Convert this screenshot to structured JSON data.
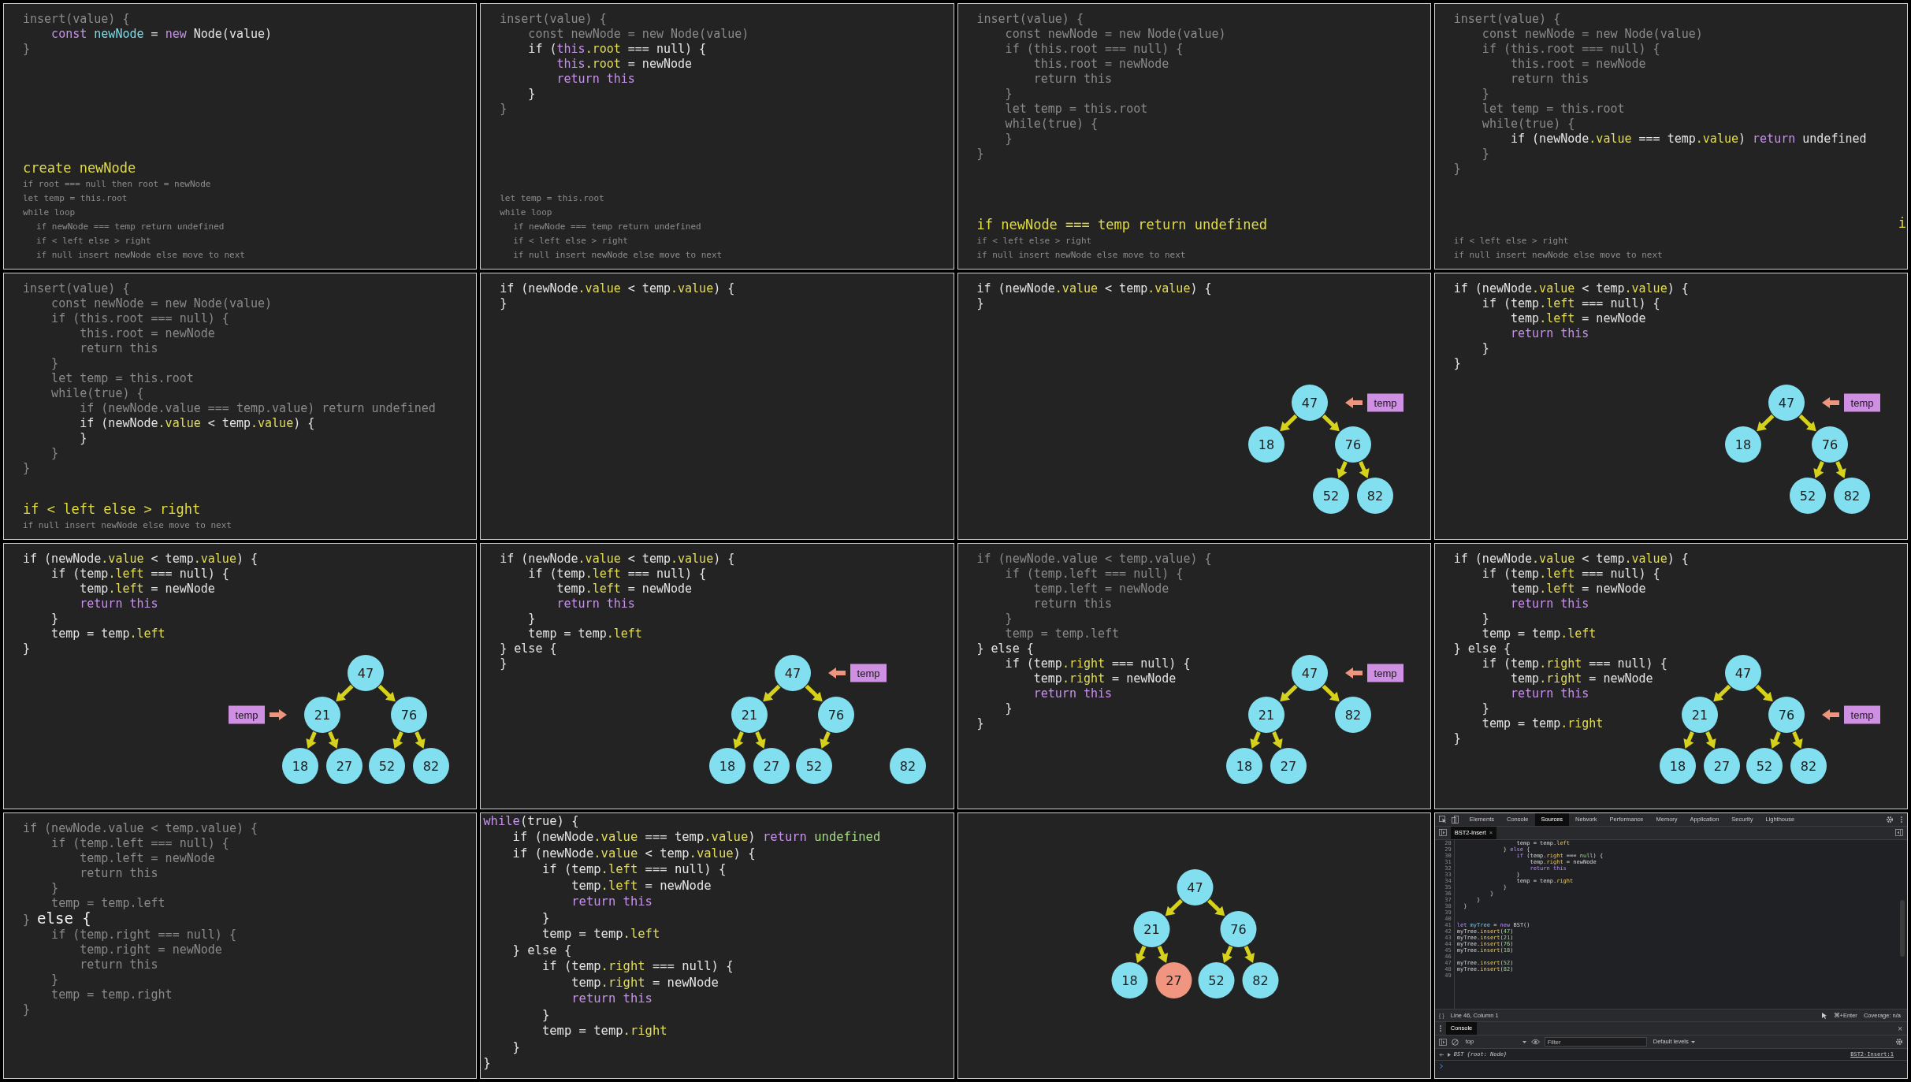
{
  "panels": [
    {
      "kind": "slide",
      "code": [
        [
          {
            "text": "insert(value) {",
            "kind": "dim"
          }
        ],
        [
          {
            "text": "    const",
            "kind": "kw"
          },
          {
            "text": " newNode",
            "kind": "decl"
          },
          {
            "text": " = ",
            "kind": "plain"
          },
          {
            "text": "new",
            "kind": "kw"
          },
          {
            "text": " Node(value)",
            "kind": "plain"
          }
        ],
        [
          {
            "text": "}",
            "kind": "dim"
          }
        ]
      ],
      "notes": [
        {
          "text": "create newNode",
          "highlighted": true
        },
        {
          "text": "if root === null then root = newNode",
          "highlighted": false
        },
        {
          "text": "let temp = this.root",
          "highlighted": false
        },
        {
          "text": "while loop",
          "highlighted": false,
          "children": [
            {
              "text": "if newNode === temp return undefined",
              "highlighted": false
            },
            {
              "text": "if < left else > right",
              "highlighted": false
            },
            {
              "text": "if null insert newNode else move to next",
              "highlighted": false
            }
          ]
        }
      ]
    },
    {
      "kind": "slide",
      "code": [
        [
          {
            "text": "insert(value) {",
            "kind": "dim"
          }
        ],
        [
          {
            "text": "    const newNode = new Node(value)",
            "kind": "dim"
          }
        ],
        [
          {
            "text": "    if (",
            "kind": "plain"
          },
          {
            "text": "this",
            "kind": "kw"
          },
          {
            "text": ".root",
            "kind": "prop"
          },
          {
            "text": " === null) {",
            "kind": "plain"
          }
        ],
        [
          {
            "text": "        this",
            "kind": "kw"
          },
          {
            "text": ".root",
            "kind": "prop"
          },
          {
            "text": " = newNode",
            "kind": "plain"
          }
        ],
        [
          {
            "text": "        return this",
            "kind": "kw"
          }
        ],
        [
          {
            "text": "    }",
            "kind": "plain"
          }
        ],
        [
          {
            "text": "}",
            "kind": "dim"
          }
        ]
      ],
      "notes": [
        {
          "text": "let temp = this.root",
          "highlighted": false
        },
        {
          "text": "while loop",
          "highlighted": false,
          "children": [
            {
              "text": "if newNode === temp return undefined",
              "highlighted": false
            },
            {
              "text": "if < left else > right",
              "highlighted": false
            },
            {
              "text": "if null insert newNode else move to next",
              "highlighted": false
            }
          ]
        }
      ]
    },
    {
      "kind": "slide",
      "code": [
        [
          {
            "text": "insert(value) {",
            "kind": "dim"
          }
        ],
        [
          {
            "text": "    const newNode = new Node(value)",
            "kind": "dim"
          }
        ],
        [
          {
            "text": "    if (this.root === null) {",
            "kind": "dim"
          }
        ],
        [
          {
            "text": "        this.root = newNode",
            "kind": "dim"
          }
        ],
        [
          {
            "text": "        return this",
            "kind": "dim"
          }
        ],
        [
          {
            "text": "    }",
            "kind": "dim"
          }
        ],
        [
          {
            "text": "    let temp = this.root",
            "kind": "dim"
          }
        ],
        [
          {
            "text": "    while(true) {",
            "kind": "dim"
          }
        ],
        [
          {
            "text": "    }",
            "kind": "dim"
          }
        ],
        [
          {
            "text": "}",
            "kind": "dim"
          }
        ]
      ],
      "notes": [
        {
          "text": "if newNode === temp return undefined",
          "highlighted": true
        },
        {
          "text": "if < left else > right",
          "highlighted": false
        },
        {
          "text": "if null insert newNode else move to next",
          "highlighted": false
        }
      ]
    },
    {
      "kind": "slide",
      "code": [
        [
          {
            "text": "insert(value) {",
            "kind": "dim"
          }
        ],
        [
          {
            "text": "    const newNode = new Node(value)",
            "kind": "dim"
          }
        ],
        [
          {
            "text": "    if (this.root === null) {",
            "kind": "dim"
          }
        ],
        [
          {
            "text": "        this.root = newNode",
            "kind": "dim"
          }
        ],
        [
          {
            "text": "        return this",
            "kind": "dim"
          }
        ],
        [
          {
            "text": "    }",
            "kind": "dim"
          }
        ],
        [
          {
            "text": "    let temp = this.root",
            "kind": "dim"
          }
        ],
        [
          {
            "text": "    while(true) {",
            "kind": "dim"
          }
        ],
        [
          {
            "text": "        if (newNode",
            "kind": "plain"
          },
          {
            "text": ".value",
            "kind": "prop"
          },
          {
            "text": " === temp",
            "kind": "plain"
          },
          {
            "text": ".value",
            "kind": "prop"
          },
          {
            "text": ") ",
            "kind": "plain"
          },
          {
            "text": "return",
            "kind": "kw"
          },
          {
            "text": " undefined",
            "kind": "plain"
          }
        ],
        [
          {
            "text": "    }",
            "kind": "dim"
          }
        ],
        [
          {
            "text": "}",
            "kind": "dim"
          }
        ]
      ],
      "notes": [
        {
          "text": "if < left else > right",
          "highlighted": false
        },
        {
          "text": "if null insert newNode else move to next",
          "highlighted": false
        }
      ],
      "incoming_note": "i"
    },
    {
      "kind": "slide",
      "code": [
        [
          {
            "text": "insert(value) {",
            "kind": "dim"
          }
        ],
        [
          {
            "text": "    const newNode = new Node(value)",
            "kind": "dim"
          }
        ],
        [
          {
            "text": "    if (this.root === null) {",
            "kind": "dim"
          }
        ],
        [
          {
            "text": "        this.root = newNode",
            "kind": "dim"
          }
        ],
        [
          {
            "text": "        return this",
            "kind": "dim"
          }
        ],
        [
          {
            "text": "    }",
            "kind": "dim"
          }
        ],
        [
          {
            "text": "    let temp = this.root",
            "kind": "dim"
          }
        ],
        [
          {
            "text": "    while(true) {",
            "kind": "dim"
          }
        ],
        [
          {
            "text": "        if (newNode.value === temp.value) return undefined",
            "kind": "dim"
          }
        ],
        [
          {
            "text": "        if (newNode",
            "kind": "plain"
          },
          {
            "text": ".value",
            "kind": "prop"
          },
          {
            "text": " < temp",
            "kind": "plain"
          },
          {
            "text": ".value",
            "kind": "prop"
          },
          {
            "text": ") {",
            "kind": "plain"
          }
        ],
        [
          {
            "text": "        }",
            "kind": "plain"
          }
        ],
        [
          {
            "text": "    }",
            "kind": "dim"
          }
        ],
        [
          {
            "text": "}",
            "kind": "dim"
          }
        ]
      ],
      "notes": [
        {
          "text": "if < left else > right",
          "highlighted": true
        },
        {
          "text": "if null insert newNode else move to next",
          "highlighted": false
        }
      ]
    },
    {
      "kind": "slide",
      "code": [
        [
          {
            "text": "if (newNode",
            "kind": "plain"
          },
          {
            "text": ".value",
            "kind": "prop"
          },
          {
            "text": " < temp",
            "kind": "plain"
          },
          {
            "text": ".value",
            "kind": "prop"
          },
          {
            "text": ") {",
            "kind": "plain"
          }
        ],
        [
          {
            "text": "}",
            "kind": "plain"
          }
        ]
      ]
    },
    {
      "kind": "slide",
      "code": [
        [
          {
            "text": "if (newNode",
            "kind": "plain"
          },
          {
            "text": ".value",
            "kind": "prop"
          },
          {
            "text": " < temp",
            "kind": "plain"
          },
          {
            "text": ".value",
            "kind": "prop"
          },
          {
            "text": ") {",
            "kind": "plain"
          }
        ],
        [
          {
            "text": "}",
            "kind": "plain"
          }
        ]
      ],
      "trees": [
        {
          "value": "47",
          "pointer": "temp",
          "children": [
            {
              "value": "18",
              "left_child": true
            },
            {
              "value": "76",
              "left_child": false,
              "children": [
                {
                  "value": "52",
                  "left_child": true
                },
                {
                  "value": "82",
                  "left_child": false
                }
              ]
            }
          ]
        }
      ]
    },
    {
      "kind": "slide",
      "code": [
        [
          {
            "text": "if (newNode",
            "kind": "plain"
          },
          {
            "text": ".value",
            "kind": "prop"
          },
          {
            "text": " < temp",
            "kind": "plain"
          },
          {
            "text": ".value",
            "kind": "prop"
          },
          {
            "text": ") {",
            "kind": "plain"
          }
        ],
        [
          {
            "text": "    if (temp",
            "kind": "plain"
          },
          {
            "text": ".left",
            "kind": "prop"
          },
          {
            "text": " === null) {",
            "kind": "plain"
          }
        ],
        [
          {
            "text": "        temp",
            "kind": "plain"
          },
          {
            "text": ".left",
            "kind": "prop"
          },
          {
            "text": " = newNode",
            "kind": "plain"
          }
        ],
        [
          {
            "text": "        return this",
            "kind": "kw"
          }
        ],
        [
          {
            "text": "    }",
            "kind": "plain"
          }
        ],
        [
          {
            "text": "}",
            "kind": "plain"
          }
        ]
      ],
      "trees": [
        {
          "value": "47",
          "pointer": "temp",
          "children": [
            {
              "value": "18",
              "left_child": true
            },
            {
              "value": "76",
              "left_child": false,
              "children": [
                {
                  "value": "52",
                  "left_child": true
                },
                {
                  "value": "82",
                  "left_child": false
                }
              ]
            }
          ]
        }
      ]
    },
    {
      "kind": "slide",
      "code": [
        [
          {
            "text": "if (newNode",
            "kind": "plain"
          },
          {
            "text": ".value",
            "kind": "prop"
          },
          {
            "text": " < temp",
            "kind": "plain"
          },
          {
            "text": ".value",
            "kind": "prop"
          },
          {
            "text": ") {",
            "kind": "plain"
          }
        ],
        [
          {
            "text": "    if (temp",
            "kind": "plain"
          },
          {
            "text": ".left",
            "kind": "prop"
          },
          {
            "text": " === null) {",
            "kind": "plain"
          }
        ],
        [
          {
            "text": "        temp",
            "kind": "plain"
          },
          {
            "text": ".left",
            "kind": "prop"
          },
          {
            "text": " = newNode",
            "kind": "plain"
          }
        ],
        [
          {
            "text": "        return this",
            "kind": "kw"
          }
        ],
        [
          {
            "text": "    }",
            "kind": "plain"
          }
        ],
        [
          {
            "text": "    temp = temp",
            "kind": "plain"
          },
          {
            "text": ".left",
            "kind": "prop"
          }
        ],
        [
          {
            "text": "}",
            "kind": "plain"
          }
        ]
      ],
      "trees": [
        {
          "value": "47",
          "children": [
            {
              "value": "21",
              "left_child": true,
              "pointer": "temp",
              "children": [
                {
                  "value": "18",
                  "left_child": true
                },
                {
                  "value": "27",
                  "left_child": false
                }
              ]
            },
            {
              "value": "76",
              "left_child": false,
              "children": [
                {
                  "value": "52",
                  "left_child": true
                },
                {
                  "value": "82",
                  "left_child": false
                }
              ]
            }
          ]
        }
      ]
    },
    {
      "kind": "slide",
      "code": [
        [
          {
            "text": "if (newNode",
            "kind": "plain"
          },
          {
            "text": ".value",
            "kind": "prop"
          },
          {
            "text": " < temp",
            "kind": "plain"
          },
          {
            "text": ".value",
            "kind": "prop"
          },
          {
            "text": ") {",
            "kind": "plain"
          }
        ],
        [
          {
            "text": "    if (temp",
            "kind": "plain"
          },
          {
            "text": ".left",
            "kind": "prop"
          },
          {
            "text": " === null) {",
            "kind": "plain"
          }
        ],
        [
          {
            "text": "        temp",
            "kind": "plain"
          },
          {
            "text": ".left",
            "kind": "prop"
          },
          {
            "text": " = newNode",
            "kind": "plain"
          }
        ],
        [
          {
            "text": "        return this",
            "kind": "kw"
          }
        ],
        [
          {
            "text": "    }",
            "kind": "plain"
          }
        ],
        [
          {
            "text": "    temp = temp",
            "kind": "plain"
          },
          {
            "text": ".left",
            "kind": "prop"
          }
        ],
        [
          {
            "text": "} else {",
            "kind": "plain"
          }
        ],
        [
          {
            "text": "}",
            "kind": "plain"
          }
        ]
      ],
      "trees": [
        {
          "value": "47",
          "pointer": "temp",
          "children": [
            {
              "value": "21",
              "left_child": true,
              "children": [
                {
                  "value": "18",
                  "left_child": true
                },
                {
                  "value": "27",
                  "left_child": false
                }
              ]
            },
            {
              "value": "76",
              "left_child": false,
              "children": [
                {
                  "value": "52",
                  "left_child": true
                }
              ]
            }
          ]
        },
        {
          "value": "82"
        }
      ]
    },
    {
      "kind": "slide",
      "code": [
        [
          {
            "text": "if (newNode.value < temp.value) {",
            "kind": "dim"
          }
        ],
        [
          {
            "text": "    if (temp.left === null) {",
            "kind": "dim"
          }
        ],
        [
          {
            "text": "        temp.left = newNode",
            "kind": "dim"
          }
        ],
        [
          {
            "text": "        return this",
            "kind": "dim"
          }
        ],
        [
          {
            "text": "    }",
            "kind": "dim"
          }
        ],
        [
          {
            "text": "    temp = temp.left",
            "kind": "dim"
          }
        ],
        [
          {
            "text": "} else {",
            "kind": "plain"
          }
        ],
        [
          {
            "text": "    if (temp",
            "kind": "plain"
          },
          {
            "text": ".right",
            "kind": "prop"
          },
          {
            "text": " === null) {",
            "kind": "plain"
          }
        ],
        [
          {
            "text": "        temp",
            "kind": "plain"
          },
          {
            "text": ".right",
            "kind": "prop"
          },
          {
            "text": " = newNode",
            "kind": "plain"
          }
        ],
        [
          {
            "text": "        return this",
            "kind": "kw"
          }
        ],
        [
          {
            "text": "    }",
            "kind": "plain"
          }
        ],
        [
          {
            "text": "}",
            "kind": "plain"
          }
        ]
      ],
      "trees": [
        {
          "value": "47",
          "pointer": "temp",
          "children": [
            {
              "value": "21",
              "left_child": true,
              "children": [
                {
                  "value": "18",
                  "left_child": true
                },
                {
                  "value": "27",
                  "left_child": false
                }
              ]
            },
            {
              "value": "82",
              "left_child": false
            }
          ]
        }
      ]
    },
    {
      "kind": "slide",
      "code": [
        [
          {
            "text": "if (newNode",
            "kind": "plain"
          },
          {
            "text": ".value",
            "kind": "prop"
          },
          {
            "text": " < temp",
            "kind": "plain"
          },
          {
            "text": ".value",
            "kind": "prop"
          },
          {
            "text": ") {",
            "kind": "plain"
          }
        ],
        [
          {
            "text": "    if (temp",
            "kind": "plain"
          },
          {
            "text": ".left",
            "kind": "prop"
          },
          {
            "text": " === null) {",
            "kind": "plain"
          }
        ],
        [
          {
            "text": "        temp",
            "kind": "plain"
          },
          {
            "text": ".left",
            "kind": "prop"
          },
          {
            "text": " = newNode",
            "kind": "plain"
          }
        ],
        [
          {
            "text": "        return this",
            "kind": "kw"
          }
        ],
        [
          {
            "text": "    }",
            "kind": "plain"
          }
        ],
        [
          {
            "text": "    temp = temp",
            "kind": "plain"
          },
          {
            "text": ".left",
            "kind": "prop"
          }
        ],
        [
          {
            "text": "} else {",
            "kind": "plain"
          }
        ],
        [
          {
            "text": "    if (temp",
            "kind": "plain"
          },
          {
            "text": ".right",
            "kind": "prop"
          },
          {
            "text": " === null) {",
            "kind": "plain"
          }
        ],
        [
          {
            "text": "        temp",
            "kind": "plain"
          },
          {
            "text": ".right",
            "kind": "prop"
          },
          {
            "text": " = newNode",
            "kind": "plain"
          }
        ],
        [
          {
            "text": "        return this",
            "kind": "kw"
          }
        ],
        [
          {
            "text": "    }",
            "kind": "plain"
          }
        ],
        [
          {
            "text": "    temp = temp",
            "kind": "plain"
          },
          {
            "text": ".right",
            "kind": "prop"
          }
        ],
        [
          {
            "text": "}",
            "kind": "plain"
          }
        ]
      ],
      "trees": [
        {
          "value": "47",
          "children": [
            {
              "value": "21",
              "left_child": true,
              "children": [
                {
                  "value": "18",
                  "left_child": true
                },
                {
                  "value": "27",
                  "left_child": false
                }
              ]
            },
            {
              "value": "76",
              "left_child": false,
              "pointer": "temp",
              "children": [
                {
                  "value": "52",
                  "left_child": true
                },
                {
                  "value": "82",
                  "left_child": false
                }
              ]
            }
          ]
        }
      ]
    },
    {
      "kind": "slide",
      "code": [
        [
          {
            "text": "if (newNode.value < temp.value) {",
            "kind": "dim"
          }
        ],
        [
          {
            "text": "    if (temp.left === null) {",
            "kind": "dim"
          }
        ],
        [
          {
            "text": "        temp.left = newNode",
            "kind": "dim"
          }
        ],
        [
          {
            "text": "        return this",
            "kind": "dim"
          }
        ],
        [
          {
            "text": "    }",
            "kind": "dim"
          }
        ],
        [
          {
            "text": "    temp = temp.left",
            "kind": "dim"
          }
        ],
        [
          {
            "text": "} ",
            "kind": "dim"
          },
          {
            "text": "else {",
            "kind": "emph"
          }
        ],
        [
          {
            "text": "    if (temp.right === null) {",
            "kind": "dim"
          }
        ],
        [
          {
            "text": "        temp.right = newNode",
            "kind": "dim"
          }
        ],
        [
          {
            "text": "        return this",
            "kind": "dim"
          }
        ],
        [
          {
            "text": "    }",
            "kind": "dim"
          }
        ],
        [
          {
            "text": "    temp = temp.right",
            "kind": "dim"
          }
        ],
        [
          {
            "text": "}",
            "kind": "dim"
          }
        ]
      ]
    },
    {
      "kind": "closeup",
      "code": [
        [
          {
            "text": "while",
            "kind": "kw"
          },
          {
            "text": "(true) {",
            "kind": "plain"
          }
        ],
        [
          {
            "text": "    if (newNode",
            "kind": "plain"
          },
          {
            "text": ".value",
            "kind": "prop"
          },
          {
            "text": " === temp",
            "kind": "plain"
          },
          {
            "text": ".value",
            "kind": "prop"
          },
          {
            "text": ") ",
            "kind": "plain"
          },
          {
            "text": "return",
            "kind": "kw"
          },
          {
            "text": " undefined",
            "kind": "num"
          }
        ],
        [
          {
            "text": "    if (newNode",
            "kind": "plain"
          },
          {
            "text": ".value",
            "kind": "prop"
          },
          {
            "text": " < temp",
            "kind": "plain"
          },
          {
            "text": ".value",
            "kind": "prop"
          },
          {
            "text": ") {",
            "kind": "plain"
          }
        ],
        [
          {
            "text": "        if (temp",
            "kind": "plain"
          },
          {
            "text": ".left",
            "kind": "prop"
          },
          {
            "text": " === null) {",
            "kind": "plain"
          }
        ],
        [
          {
            "text": "            temp",
            "kind": "plain"
          },
          {
            "text": ".left",
            "kind": "prop"
          },
          {
            "text": " = newNode",
            "kind": "plain"
          }
        ],
        [
          {
            "text": "            return this",
            "kind": "kw"
          }
        ],
        [
          {
            "text": "        }",
            "kind": "plain"
          }
        ],
        [
          {
            "text": "        temp = temp",
            "kind": "plain"
          },
          {
            "text": ".left",
            "kind": "prop"
          }
        ],
        [
          {
            "text": "    } else {",
            "kind": "plain"
          }
        ],
        [
          {
            "text": "        if (temp",
            "kind": "plain"
          },
          {
            "text": ".right",
            "kind": "prop"
          },
          {
            "text": " === null) {",
            "kind": "plain"
          }
        ],
        [
          {
            "text": "            temp",
            "kind": "plain"
          },
          {
            "text": ".right",
            "kind": "prop"
          },
          {
            "text": " = newNode",
            "kind": "plain"
          }
        ],
        [
          {
            "text": "            return this",
            "kind": "kw"
          }
        ],
        [
          {
            "text": "        }",
            "kind": "plain"
          }
        ],
        [
          {
            "text": "        temp = temp",
            "kind": "plain"
          },
          {
            "text": ".right",
            "kind": "prop"
          }
        ],
        [
          {
            "text": "    }",
            "kind": "plain"
          }
        ],
        [
          {
            "text": "}",
            "kind": "plain"
          }
        ]
      ]
    },
    {
      "kind": "slide",
      "trees": [
        {
          "value": "47",
          "highlighted": false,
          "children": [
            {
              "value": "21",
              "left_child": true,
              "highlighted": false,
              "children": [
                {
                  "value": "18",
                  "left_child": true,
                  "highlighted": false
                },
                {
                  "value": "27",
                  "left_child": false,
                  "highlighted": true
                }
              ]
            },
            {
              "value": "76",
              "left_child": false,
              "highlighted": false,
              "children": [
                {
                  "value": "52",
                  "left_child": true,
                  "highlighted": false
                },
                {
                  "value": "82",
                  "left_child": false,
                  "highlighted": false
                }
              ]
            }
          ]
        }
      ]
    },
    {
      "kind": "devtools",
      "tabs": [
        {
          "label": "Elements",
          "selected": false
        },
        {
          "label": "Console",
          "selected": false
        },
        {
          "label": "Sources",
          "selected": true
        },
        {
          "label": "Network",
          "selected": false
        },
        {
          "label": "Performance",
          "selected": false
        },
        {
          "label": "Memory",
          "selected": false
        },
        {
          "label": "Application",
          "selected": false
        },
        {
          "label": "Security",
          "selected": false
        },
        {
          "label": "Lighthouse",
          "selected": false
        }
      ],
      "file_tab": {
        "label": "BST2-Insert",
        "close": "×"
      },
      "lines": [
        {
          "number": "28",
          "segments": [
            {
              "text": "                  temp = temp",
              "kind": "plain"
            },
            {
              "text": ".left",
              "kind": "prop"
            }
          ]
        },
        {
          "number": "29",
          "segments": [
            {
              "text": "              } ",
              "kind": "plain"
            },
            {
              "text": "else",
              "kind": "kw"
            },
            {
              "text": " {",
              "kind": "plain"
            }
          ]
        },
        {
          "number": "30",
          "segments": [
            {
              "text": "                  if",
              "kind": "kw"
            },
            {
              "text": " (temp",
              "kind": "plain"
            },
            {
              "text": ".right",
              "kind": "prop"
            },
            {
              "text": " === ",
              "kind": "plain"
            },
            {
              "text": "null",
              "kind": "num"
            },
            {
              "text": ") {",
              "kind": "plain"
            }
          ]
        },
        {
          "number": "31",
          "segments": [
            {
              "text": "                      temp",
              "kind": "plain"
            },
            {
              "text": ".right",
              "kind": "prop"
            },
            {
              "text": " = newNode",
              "kind": "plain"
            }
          ]
        },
        {
          "number": "32",
          "segments": [
            {
              "text": "                      return this",
              "kind": "kw"
            }
          ]
        },
        {
          "number": "33",
          "segments": [
            {
              "text": "                  }",
              "kind": "plain"
            }
          ]
        },
        {
          "number": "34",
          "segments": [
            {
              "text": "                  temp = temp",
              "kind": "plain"
            },
            {
              "text": ".right",
              "kind": "prop"
            }
          ]
        },
        {
          "number": "35",
          "segments": [
            {
              "text": "              }",
              "kind": "plain"
            }
          ]
        },
        {
          "number": "36",
          "segments": [
            {
              "text": "          }",
              "kind": "plain"
            }
          ]
        },
        {
          "number": "37",
          "segments": [
            {
              "text": "      }",
              "kind": "plain"
            }
          ]
        },
        {
          "number": "38",
          "segments": [
            {
              "text": "  }",
              "kind": "plain"
            }
          ]
        },
        {
          "number": "39"
        },
        {
          "number": "40"
        },
        {
          "number": "41",
          "segments": [
            {
              "text": "let",
              "kind": "kw"
            },
            {
              "text": " myTree",
              "kind": "decl"
            },
            {
              "text": " = ",
              "kind": "plain"
            },
            {
              "text": "new",
              "kind": "kw"
            },
            {
              "text": " BST()",
              "kind": "plain"
            }
          ]
        },
        {
          "number": "42",
          "segments": [
            {
              "text": "myTree",
              "kind": "plain"
            },
            {
              "text": ".insert",
              "kind": "prop"
            },
            {
              "text": "(",
              "kind": "plain"
            },
            {
              "text": "47",
              "kind": "num"
            },
            {
              "text": ")",
              "kind": "plain"
            }
          ]
        },
        {
          "number": "43",
          "segments": [
            {
              "text": "myTree",
              "kind": "plain"
            },
            {
              "text": ".insert",
              "kind": "prop"
            },
            {
              "text": "(",
              "kind": "plain"
            },
            {
              "text": "21",
              "kind": "num"
            },
            {
              "text": ")",
              "kind": "plain"
            }
          ]
        },
        {
          "number": "44",
          "segments": [
            {
              "text": "myTree",
              "kind": "plain"
            },
            {
              "text": ".insert",
              "kind": "prop"
            },
            {
              "text": "(",
              "kind": "plain"
            },
            {
              "text": "76",
              "kind": "num"
            },
            {
              "text": ")",
              "kind": "plain"
            }
          ]
        },
        {
          "number": "45",
          "segments": [
            {
              "text": "myTree",
              "kind": "plain"
            },
            {
              "text": ".insert",
              "kind": "prop"
            },
            {
              "text": "(",
              "kind": "plain"
            },
            {
              "text": "18",
              "kind": "num"
            },
            {
              "text": ")",
              "kind": "plain"
            }
          ]
        },
        {
          "number": "46"
        },
        {
          "number": "47",
          "segments": [
            {
              "text": "myTree",
              "kind": "plain"
            },
            {
              "text": ".insert",
              "kind": "prop"
            },
            {
              "text": "(",
              "kind": "plain"
            },
            {
              "text": "52",
              "kind": "num"
            },
            {
              "text": ")",
              "kind": "plain"
            }
          ]
        },
        {
          "number": "48",
          "segments": [
            {
              "text": "myTree",
              "kind": "plain"
            },
            {
              "text": ".insert",
              "kind": "prop"
            },
            {
              "text": "(",
              "kind": "plain"
            },
            {
              "text": "82",
              "kind": "num"
            },
            {
              "text": ")",
              "kind": "plain"
            }
          ]
        },
        {
          "number": "49"
        }
      ],
      "status": {
        "format": "{ }",
        "position": "Line 46, Column 1",
        "run": "⌘+Enter",
        "coverage": "Coverage: n/a"
      },
      "drawer_tabs": [
        {
          "label": "Console",
          "selected": true
        }
      ],
      "drawer_close": "×",
      "context": "top",
      "filter": {
        "placeholder": "Filter"
      },
      "levels": "Default levels",
      "output": {
        "text": "BST {root: Node}",
        "source": "BST2-Insert:1"
      }
    }
  ]
}
